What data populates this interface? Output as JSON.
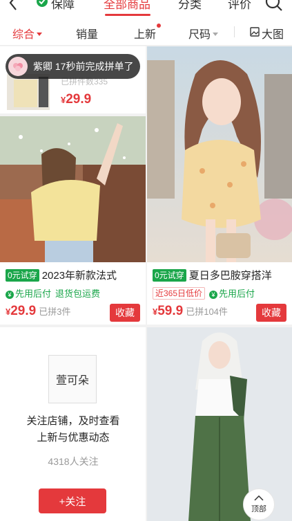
{
  "top_tabs": {
    "guarantee": "保障",
    "all_products": "全部商品",
    "category": "分类",
    "reviews": "评价"
  },
  "sort_bar": {
    "overall": "综合",
    "sales": "销量",
    "new": "上新",
    "size": "尺码",
    "big_image": "大图"
  },
  "toast": {
    "text": "紫卿 17秒前完成拼单了"
  },
  "partial_card": {
    "faded_text": "已拼件数335",
    "price_symbol": "¥",
    "price": "29.9"
  },
  "products": [
    {
      "trial_badge": "0元试穿",
      "title": "2023年新款法式",
      "tag1": "先用后付",
      "tag2": "退货包运费",
      "price_symbol": "¥",
      "price": "29.9",
      "sold": "已拼3件",
      "collect": "收藏"
    },
    {
      "trial_badge": "0元试穿",
      "title": "夏日多巴胺穿搭洋",
      "low_price_tag": "近365日低价",
      "tag1": "先用后付",
      "price_symbol": "¥",
      "price": "59.9",
      "sold": "已拼104件",
      "collect": "收藏"
    }
  ],
  "store_card": {
    "name": "萱可朵",
    "message_line1": "关注店铺，及时查看",
    "message_line2": "上新与优惠动态",
    "followers": "4318人关注",
    "follow_button": "+关注"
  },
  "back_to_top": "顶部",
  "colors": {
    "accent": "#e4393c",
    "green": "#1aa64a"
  }
}
